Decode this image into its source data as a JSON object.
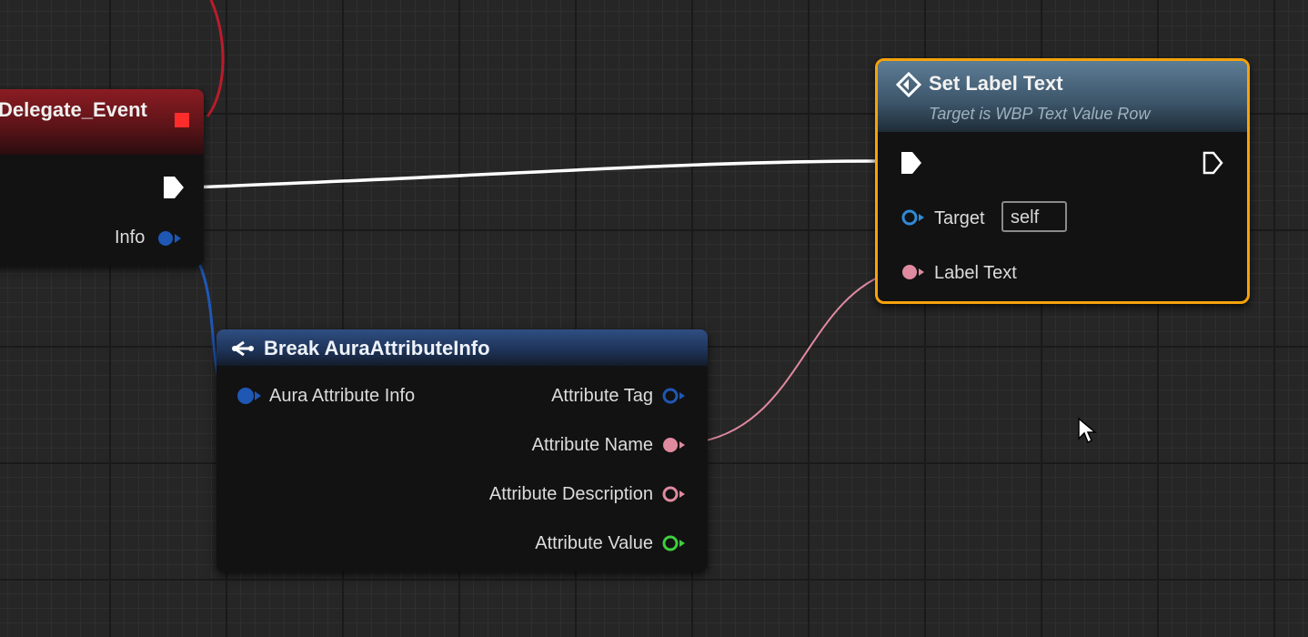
{
  "colors": {
    "exec_wire": "#ffffff",
    "struct_wire": "#1f57b5",
    "text_wire": "#e08aa0",
    "event_wire": "#b91c2c",
    "selection": "#f5a20a"
  },
  "event_node": {
    "title": "Delegate_Event",
    "pins": {
      "info": "Info"
    }
  },
  "set_label_node": {
    "title": "Set Label Text",
    "subtitle": "Target is WBP Text Value Row",
    "icon": "function-diamond-icon",
    "pins": {
      "target": "Target",
      "target_value": "self",
      "label_text": "Label Text"
    }
  },
  "break_node": {
    "title": "Break AuraAttributeInfo",
    "icon": "break-struct-icon",
    "pins": {
      "input": "Aura Attribute Info",
      "attribute_tag": "Attribute Tag",
      "attribute_name": "Attribute Name",
      "attribute_description": "Attribute Description",
      "attribute_value": "Attribute Value"
    }
  }
}
